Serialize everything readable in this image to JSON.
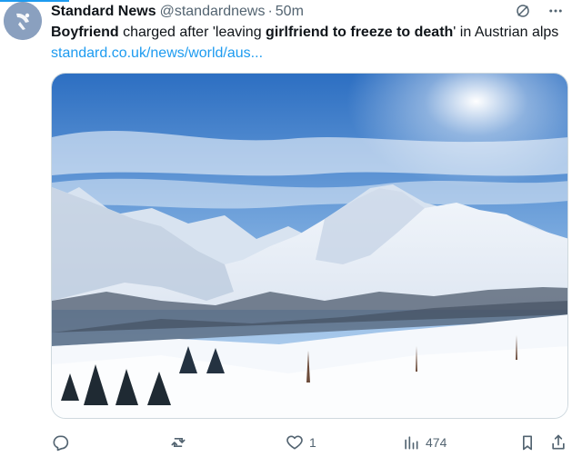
{
  "tweet": {
    "author_name": "Standard News",
    "handle": "@standardnews",
    "separator": "·",
    "time": "50m",
    "text": {
      "p1": "Boyfriend",
      "p2": " charged after 'leaving ",
      "p3": "girlfriend to freeze to death",
      "p4": "' in Austrian alps ",
      "link": "standard.co.uk/news/world/aus..."
    },
    "media_alt": "Snowy alpine mountains with ski lifts under a blue sky",
    "stats": {
      "likes": "1",
      "views": "474"
    }
  },
  "icons": {
    "header": [
      "grok-icon",
      "more-icon"
    ],
    "actions": [
      "reply-icon",
      "retweet-icon",
      "like-icon",
      "views-icon",
      "bookmark-icon",
      "share-icon"
    ]
  },
  "colors": {
    "accent": "#1d9bf0",
    "muted": "#536471",
    "text": "#0f1419"
  }
}
